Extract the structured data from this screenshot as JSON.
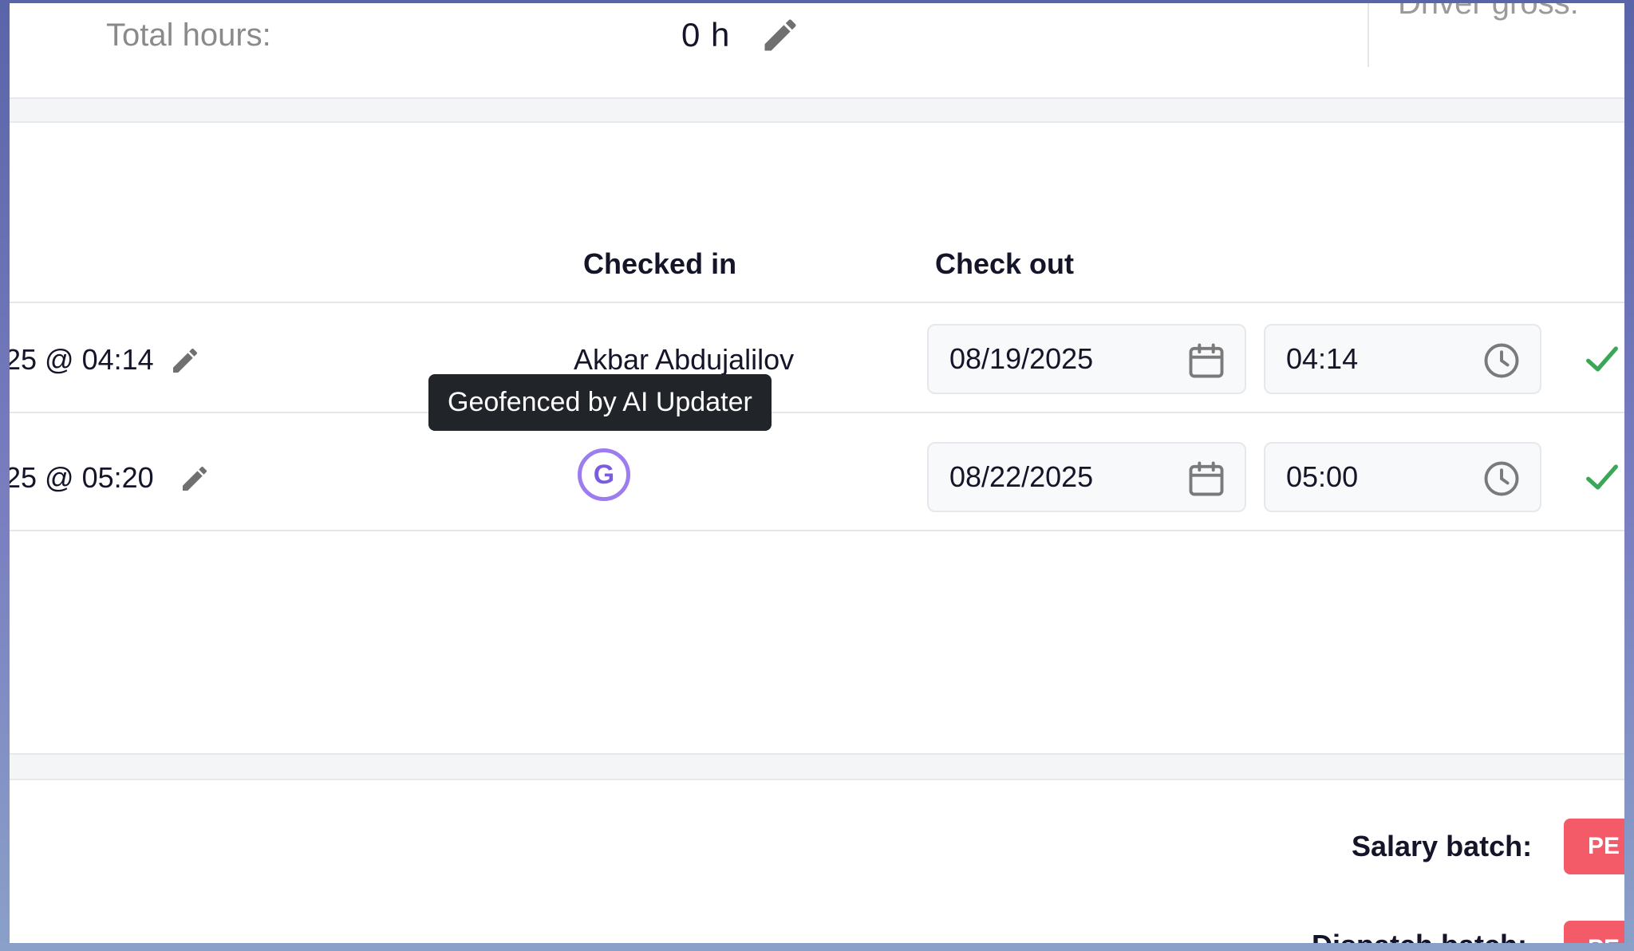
{
  "summary": {
    "total_hours_label": "Total hours:",
    "total_hours_value": "0 h",
    "driver_gross_label": "Driver gross:"
  },
  "table": {
    "headers": {
      "checked_in": "Checked in",
      "check_out": "Check out"
    },
    "rows": [
      {
        "date_time": "25 @ 04:14",
        "checked_in": "Akbar Abdujalilov",
        "checkout_date": "08/19/2025",
        "checkout_time": "04:14"
      },
      {
        "date_time": "25 @ 05:20",
        "checked_in_icon_letter": "G",
        "checkout_date": "08/22/2025",
        "checkout_time": "05:00"
      }
    ]
  },
  "tooltip": {
    "text": "Geofenced by AI Updater"
  },
  "footer": {
    "salary_batch_label": "Salary batch:",
    "salary_batch_status": "PE",
    "dispatch_label": "Dispatch batch:",
    "dispatch_status": "PE"
  },
  "icons": {
    "edit": "pencil-icon",
    "calendar": "calendar-icon",
    "clock": "clock-icon",
    "confirm": "checkmark-icon",
    "geofence": "geofence-badge-icon"
  },
  "colors": {
    "accent_purple": "#9d7cf0",
    "confirm_green": "#3aa757",
    "status_red": "#f45b69",
    "tooltip_bg": "#212529"
  }
}
